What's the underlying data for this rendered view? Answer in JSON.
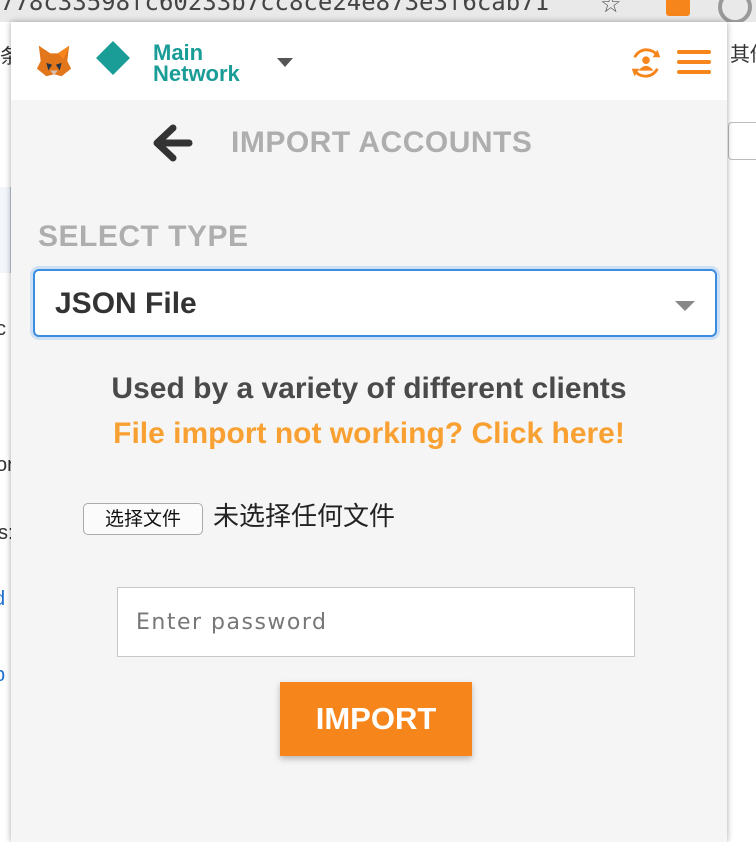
{
  "browser": {
    "url_fragment": "778c33598fc60233b7cc8ce24e873e3f6cab71",
    "background_fragments": [
      "条",
      "其他",
      "c",
      "or",
      "s:",
      "d",
      "b"
    ]
  },
  "header": {
    "network_name": "Main\nNetwork",
    "network_color": "#1a9c97",
    "accent_color": "#f6851b",
    "logo_icon": "metamask-fox-icon",
    "network_icon": "diamond-icon",
    "sync_icon": "account-sync-icon",
    "menu_icon": "hamburger-menu-icon"
  },
  "import_page": {
    "title": "IMPORT ACCOUNTS",
    "select_label": "SELECT TYPE",
    "selected_type": "JSON File",
    "description": "Used by a variety of different clients",
    "help_link": "File import not working? Click here!",
    "help_link_color": "#f8a132",
    "file_button_label": "选择文件",
    "file_status": "未选择任何文件",
    "password_placeholder": "Enter password",
    "password_value": "",
    "import_button_label": "IMPORT"
  }
}
